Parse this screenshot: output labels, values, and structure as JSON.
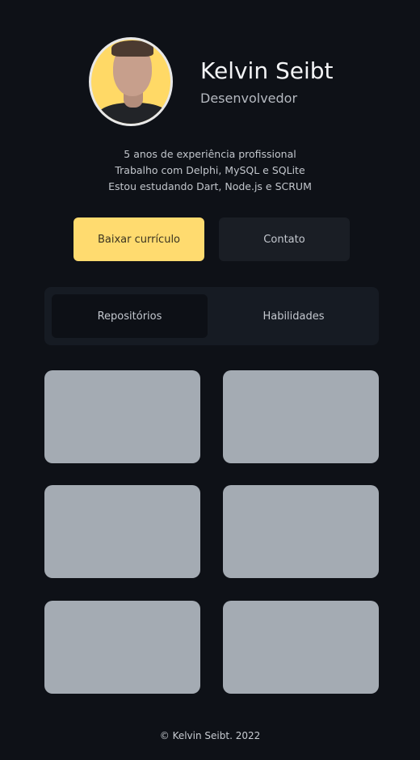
{
  "profile": {
    "name": "Kelvin Seibt",
    "role": "Desenvolvedor"
  },
  "bio": {
    "line1": "5 anos de experiência profissional",
    "line2": "Trabalho com Delphi, MySQL e SQLite",
    "line3": "Estou estudando Dart, Node.js e SCRUM"
  },
  "actions": {
    "download_label": "Baixar currículo",
    "contact_label": "Contato"
  },
  "tabs": [
    {
      "label": "Repositórios",
      "active": true
    },
    {
      "label": "Habilidades",
      "active": false
    }
  ],
  "colors": {
    "background": "#0e1117",
    "accent": "#ffdb6f",
    "card": "#a4abb3"
  },
  "footer": {
    "copyright": "© Kelvin Seibt. 2022"
  }
}
